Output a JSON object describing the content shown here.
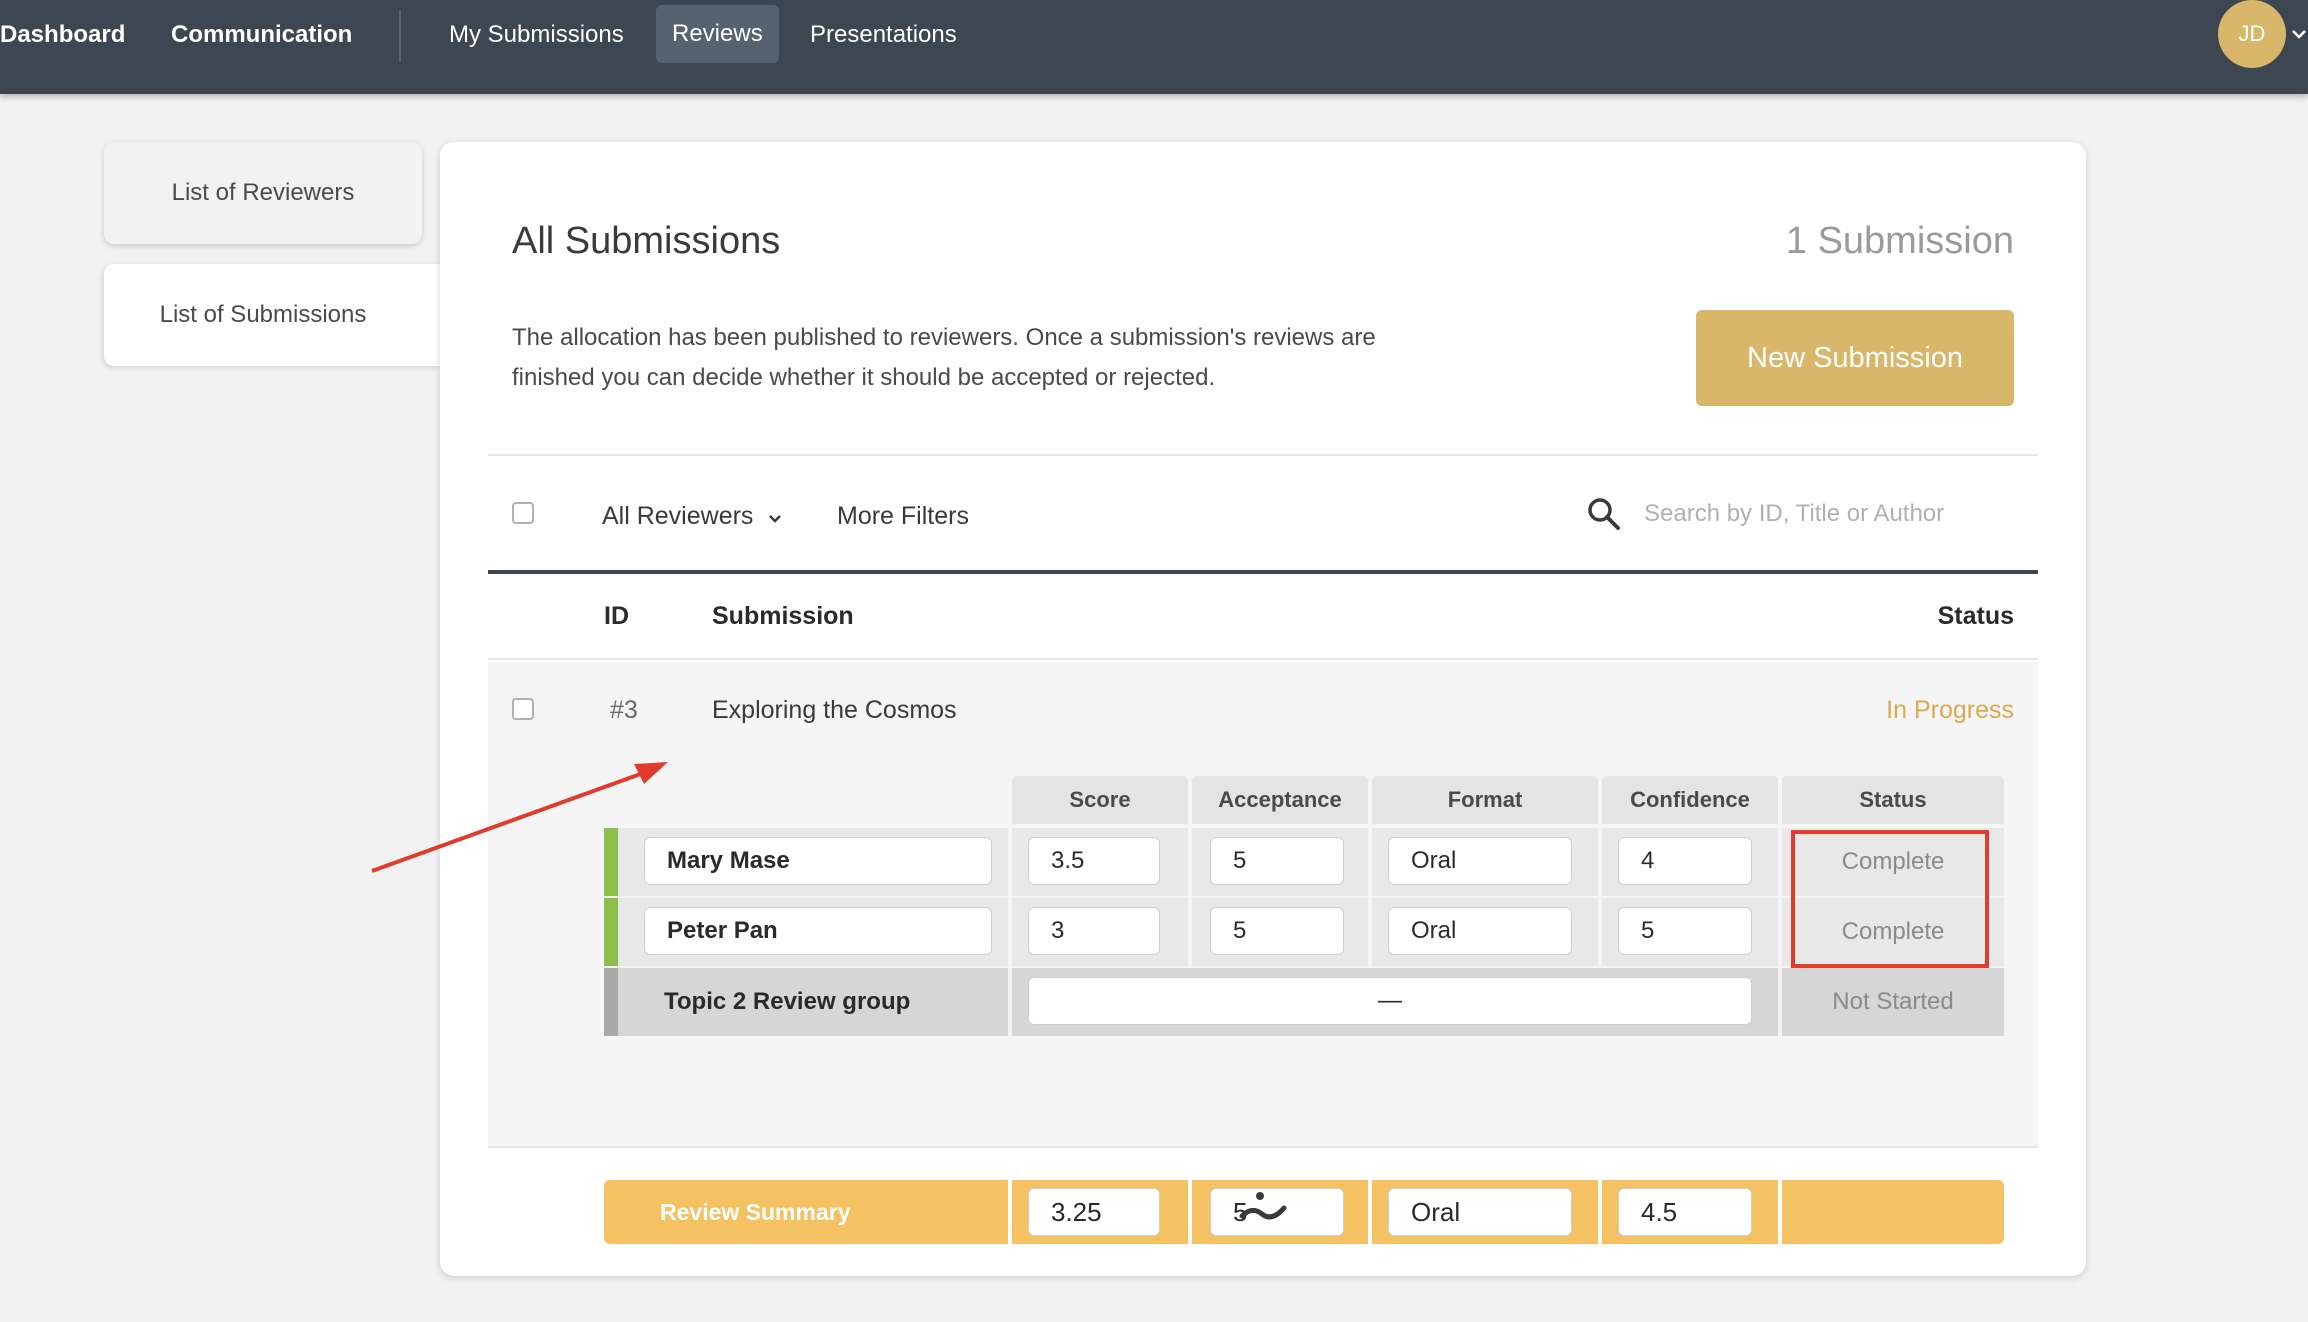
{
  "nav": {
    "dashboard": "Dashboard",
    "communication": "Communication",
    "my_submissions": "My Submissions",
    "reviews": "Reviews",
    "presentations": "Presentations",
    "avatar_initials": "JD"
  },
  "sidebar": {
    "items": [
      {
        "label": "List of Reviewers"
      },
      {
        "label": "List of Submissions"
      }
    ]
  },
  "main": {
    "title": "All Submissions",
    "count": "1 Submission",
    "description": "The allocation has been published to reviewers. Once a submission's reviews are finished you can decide whether it should be accepted or rejected.",
    "new_button": "New Submission"
  },
  "filters": {
    "reviewers": "All Reviewers",
    "more": "More Filters",
    "search_placeholder": "Search by ID, Title or Author"
  },
  "table": {
    "headers": {
      "id": "ID",
      "submission": "Submission",
      "status": "Status"
    },
    "rows": [
      {
        "id": "#3",
        "title": "Exploring the Cosmos",
        "status": "In Progress",
        "review_headers": [
          "Score",
          "Acceptance",
          "Format",
          "Confidence",
          "Status"
        ],
        "reviews": [
          {
            "name": "Mary Mase",
            "score": "3.5",
            "acceptance": "5",
            "format": "Oral",
            "confidence": "4",
            "status": "Complete"
          },
          {
            "name": "Peter Pan",
            "score": "3",
            "acceptance": "5",
            "format": "Oral",
            "confidence": "5",
            "status": "Complete"
          }
        ],
        "group": {
          "name": "Topic 2 Review group",
          "value": "—",
          "status": "Not Started"
        },
        "summary": {
          "label": "Review Summary",
          "score": "3.25",
          "acceptance": "5",
          "format": "Oral",
          "confidence": "4.5"
        }
      }
    ]
  },
  "colors": {
    "topbar": "#3d4752",
    "accent_gold": "#d8b76a",
    "summary_yellow": "#f4c263",
    "complete_bar": "#8dc04b",
    "group_bar": "#a9a9a9",
    "annotation_red": "#e03c2c"
  }
}
